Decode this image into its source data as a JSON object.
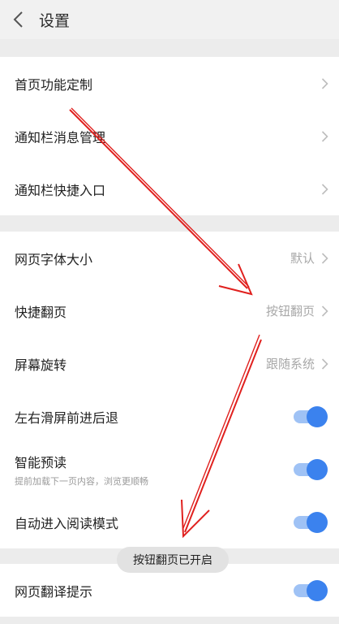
{
  "header": {
    "title": "设置",
    "back_icon": "chevron-left-icon"
  },
  "groups": [
    {
      "items": [
        {
          "label": "首页功能定制"
        },
        {
          "label": "通知栏消息管理"
        },
        {
          "label": "通知栏快捷入口"
        }
      ]
    },
    {
      "items": [
        {
          "label": "网页字体大小",
          "value": "默认"
        },
        {
          "label": "快捷翻页",
          "value": "按钮翻页"
        },
        {
          "label": "屏幕旋转",
          "value": "跟随系统"
        },
        {
          "label": "左右滑屏前进后退",
          "toggle": true
        },
        {
          "label": "智能预读",
          "sublabel": "提前加载下一页内容，浏览更顺畅",
          "toggle": true
        },
        {
          "label": "自动进入阅读模式",
          "toggle": true
        }
      ]
    },
    {
      "items": [
        {
          "label": "网页翻译提示",
          "toggle": true
        }
      ]
    }
  ],
  "toast": {
    "text": "按钮翻页已开启"
  },
  "colors": {
    "toggle_knob": "#3b82ee",
    "toggle_track": "#9fc2f5",
    "annotation_arrow": "#e0201e",
    "background": "#ececec"
  }
}
